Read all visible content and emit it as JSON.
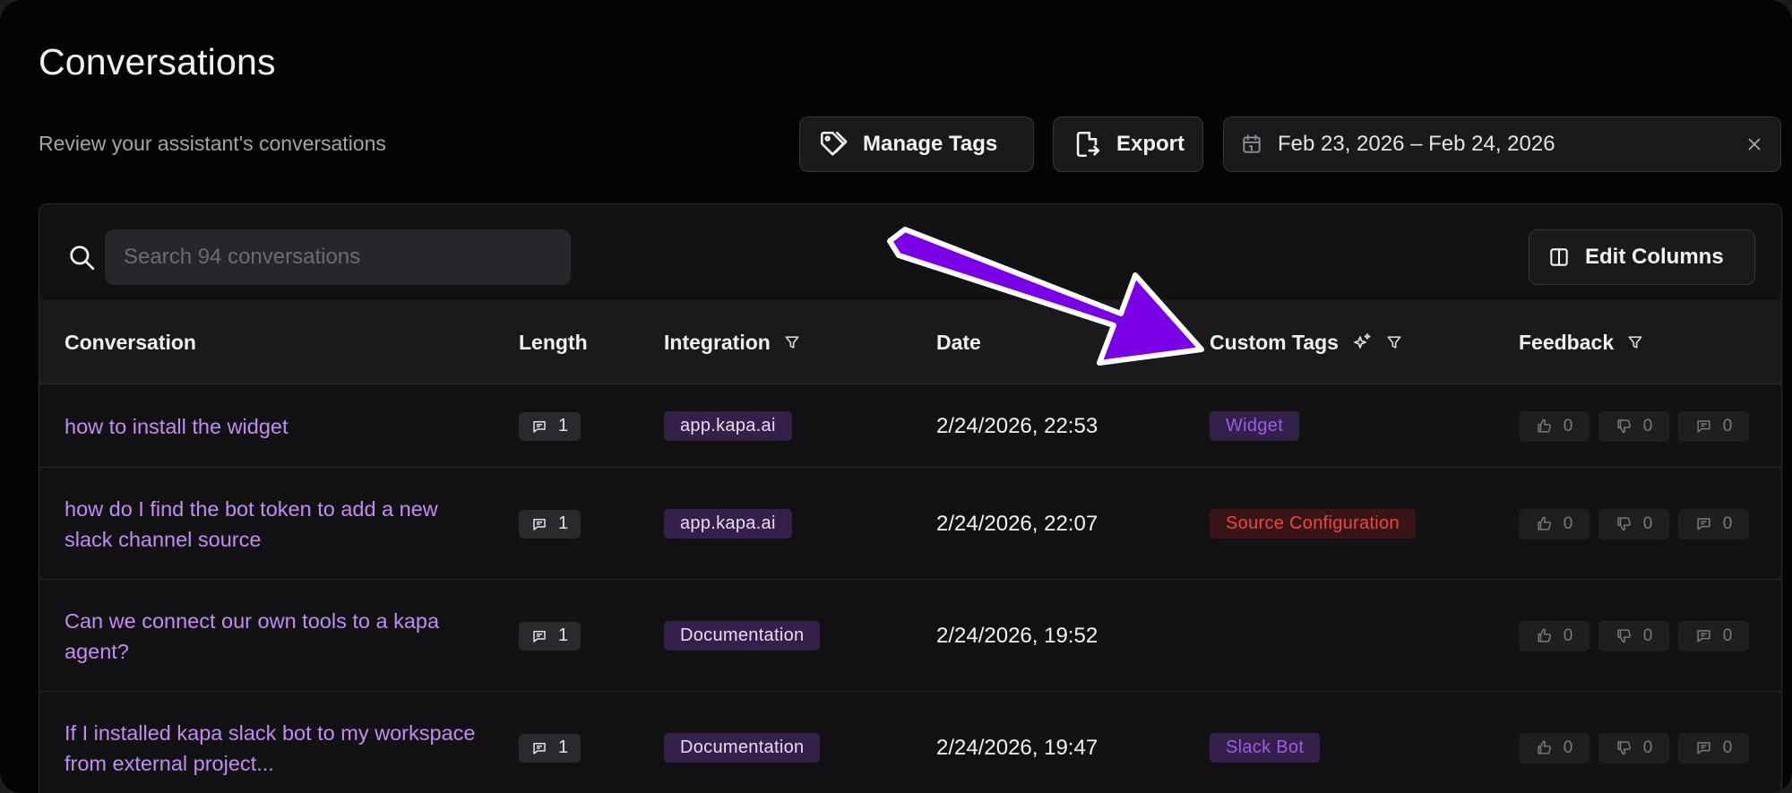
{
  "header": {
    "title": "Conversations",
    "subtitle": "Review your assistant's conversations"
  },
  "toolbar": {
    "manage_tags_label": "Manage Tags",
    "export_label": "Export",
    "date_range": "Feb 23, 2026 – Feb 24, 2026"
  },
  "search": {
    "placeholder": "Search 94 conversations",
    "value": ""
  },
  "edit_columns_label": "Edit Columns",
  "columns": {
    "conversation": "Conversation",
    "length": "Length",
    "integration": "Integration",
    "date": "Date",
    "custom_tags": "Custom Tags",
    "feedback": "Feedback"
  },
  "rows": [
    {
      "title": "how to install the widget",
      "length": "1",
      "integration": "app.kapa.ai",
      "date": "2/24/2026, 22:53",
      "tag": "Widget",
      "tag_style": "purple",
      "thumbs_up": "0",
      "thumbs_down": "0",
      "comments": "0"
    },
    {
      "title": "how do I find the bot token to add a new slack channel source",
      "length": "1",
      "integration": "app.kapa.ai",
      "date": "2/24/2026, 22:07",
      "tag": "Source Configuration",
      "tag_style": "red",
      "thumbs_up": "0",
      "thumbs_down": "0",
      "comments": "0"
    },
    {
      "title": "Can we connect our own tools to a kapa agent?",
      "length": "1",
      "integration": "Documentation",
      "date": "2/24/2026, 19:52",
      "tag": "",
      "tag_style": "none",
      "thumbs_up": "0",
      "thumbs_down": "0",
      "comments": "0"
    },
    {
      "title": "If I installed kapa slack bot to my workspace from external project...",
      "length": "1",
      "integration": "Documentation",
      "date": "2/24/2026, 19:47",
      "tag": "Slack Bot",
      "tag_style": "purple",
      "thumbs_up": "0",
      "thumbs_down": "0",
      "comments": "0"
    }
  ],
  "colors": {
    "accent_link": "#c38cf3",
    "arrow": "#7a00e6",
    "tag_purple_bg": "#33214a",
    "tag_purple_text": "#9d5ce6",
    "tag_red_bg": "#3a1517",
    "tag_red_text": "#ef4444"
  }
}
